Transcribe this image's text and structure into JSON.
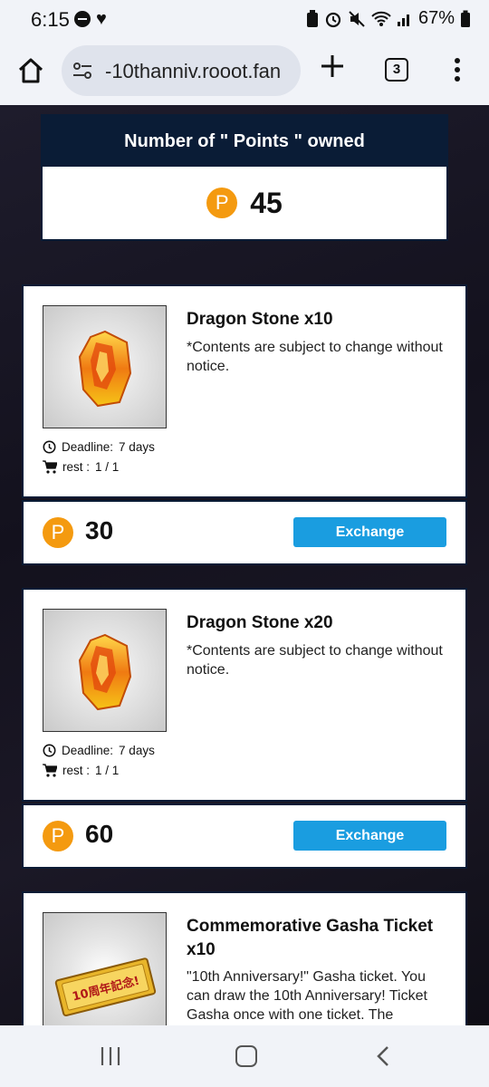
{
  "status_bar": {
    "time": "6:15",
    "battery": "67%"
  },
  "browser": {
    "url": "-10thanniv.rooot.fan",
    "tab_count": "3"
  },
  "points": {
    "header": "Number of \" Points \" owned",
    "value": "45",
    "coin_symbol": "P"
  },
  "items": [
    {
      "title": "Dragon Stone x10",
      "description": "*Contents are subject to change without notice.",
      "deadline_label": "Deadline:",
      "deadline_value": "7 days",
      "rest_label": "rest :",
      "rest_value": "1 / 1",
      "price": "30",
      "button": "Exchange"
    },
    {
      "title": "Dragon Stone x20",
      "description": "*Contents are subject to change without notice.",
      "deadline_label": "Deadline:",
      "deadline_value": "7 days",
      "rest_label": "rest :",
      "rest_value": "1 / 1",
      "price": "60",
      "button": "Exchange"
    },
    {
      "title": "Commemorative Gasha Ticket x10",
      "description": "\"10th Anniversary!\" Gasha ticket. You can draw the 10th Anniversary! Ticket Gasha once with one ticket. The",
      "ticket_text": "10周年記念!"
    }
  ],
  "colors": {
    "header_navy": "#0a1c36",
    "coin_orange": "#f49a10",
    "button_blue": "#1a9de0"
  }
}
